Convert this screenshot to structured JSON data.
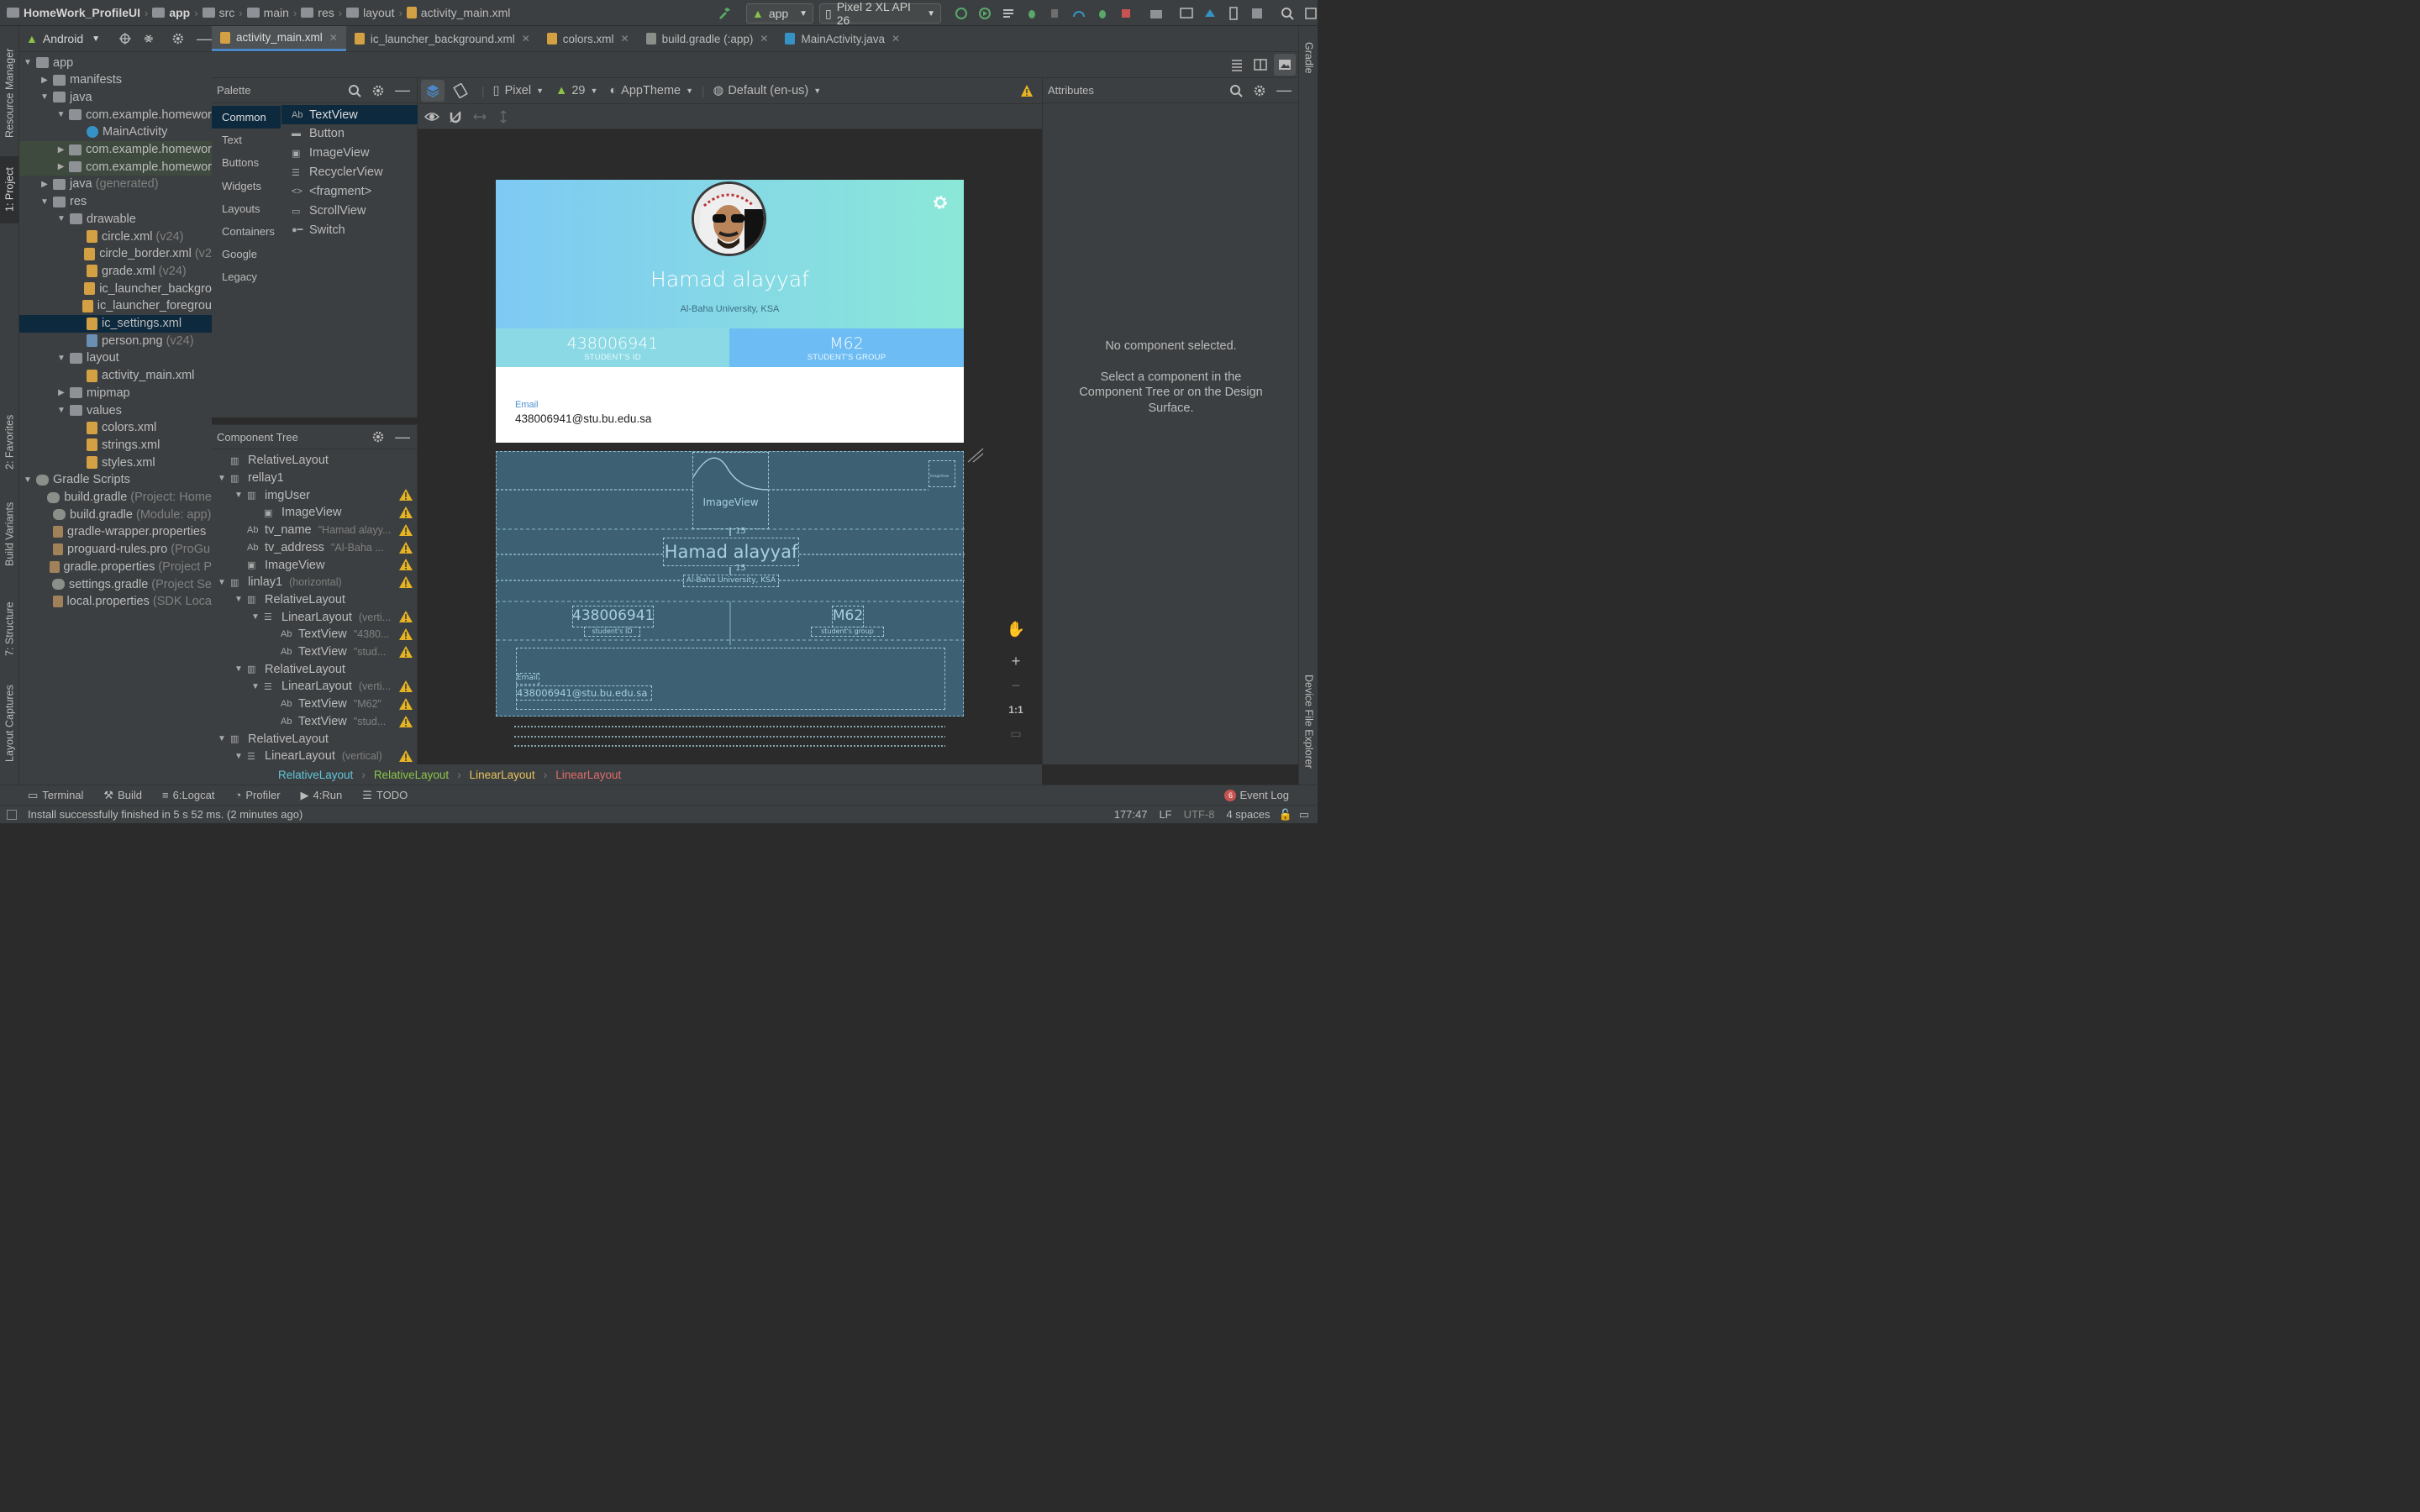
{
  "breadcrumbs": {
    "project": "HomeWork_ProfileUI",
    "items": [
      "app",
      "src",
      "main",
      "res",
      "layout",
      "activity_main.xml"
    ]
  },
  "toolbar": {
    "run_config": "app",
    "device": "Pixel 2 XL API 26"
  },
  "left_stripe": {
    "resource_manager": "Resource Manager",
    "project": "1: Project",
    "favorites": "2: Favorites",
    "build_variants": "Build Variants",
    "structure": "7: Structure",
    "layout_captures": "Layout Captures"
  },
  "right_stripe": {
    "gradle": "Gradle",
    "device_file_explorer": "Device File Explorer"
  },
  "project_panel": {
    "view_mode": "Android",
    "tree": [
      {
        "label": "app",
        "hint": "",
        "kind": "dir",
        "level": 0,
        "arrow": "down"
      },
      {
        "label": "manifests",
        "hint": "",
        "kind": "dir",
        "level": 1,
        "arrow": "right"
      },
      {
        "label": "java",
        "hint": "",
        "kind": "dir",
        "level": 1,
        "arrow": "down"
      },
      {
        "label": "com.example.homewor",
        "hint": "",
        "kind": "dir",
        "level": 2,
        "arrow": "down"
      },
      {
        "label": "MainActivity",
        "hint": "",
        "kind": "cls",
        "level": 3,
        "arrow": ""
      },
      {
        "label": "com.example.homewor",
        "hint": "",
        "kind": "dir",
        "level": 2,
        "arrow": "right",
        "hl": true
      },
      {
        "label": "com.example.homewor",
        "hint": "",
        "kind": "dir",
        "level": 2,
        "arrow": "right",
        "hl": true
      },
      {
        "label": "java",
        "hint": "(generated)",
        "kind": "dir",
        "level": 1,
        "arrow": "right"
      },
      {
        "label": "res",
        "hint": "",
        "kind": "dir",
        "level": 1,
        "arrow": "down"
      },
      {
        "label": "drawable",
        "hint": "",
        "kind": "dir",
        "level": 2,
        "arrow": "down"
      },
      {
        "label": "circle.xml",
        "hint": "(v24)",
        "kind": "xml",
        "level": 3,
        "arrow": ""
      },
      {
        "label": "circle_border.xml",
        "hint": "(v2",
        "kind": "xml",
        "level": 3,
        "arrow": ""
      },
      {
        "label": "grade.xml",
        "hint": "(v24)",
        "kind": "xml",
        "level": 3,
        "arrow": ""
      },
      {
        "label": "ic_launcher_backgro",
        "hint": "",
        "kind": "xml",
        "level": 3,
        "arrow": ""
      },
      {
        "label": "ic_launcher_foregrou",
        "hint": "",
        "kind": "xml",
        "level": 3,
        "arrow": ""
      },
      {
        "label": "ic_settings.xml",
        "hint": "",
        "kind": "xml",
        "level": 3,
        "arrow": "",
        "sel": true
      },
      {
        "label": "person.png",
        "hint": "(v24)",
        "kind": "png",
        "level": 3,
        "arrow": ""
      },
      {
        "label": "layout",
        "hint": "",
        "kind": "dir",
        "level": 2,
        "arrow": "down"
      },
      {
        "label": "activity_main.xml",
        "hint": "",
        "kind": "xml",
        "level": 3,
        "arrow": ""
      },
      {
        "label": "mipmap",
        "hint": "",
        "kind": "dir",
        "level": 2,
        "arrow": "right"
      },
      {
        "label": "values",
        "hint": "",
        "kind": "dir",
        "level": 2,
        "arrow": "down"
      },
      {
        "label": "colors.xml",
        "hint": "",
        "kind": "xml",
        "level": 3,
        "arrow": ""
      },
      {
        "label": "strings.xml",
        "hint": "",
        "kind": "xml",
        "level": 3,
        "arrow": ""
      },
      {
        "label": "styles.xml",
        "hint": "",
        "kind": "xml",
        "level": 3,
        "arrow": ""
      },
      {
        "label": "Gradle Scripts",
        "hint": "",
        "kind": "grd",
        "level": 0,
        "arrow": "down"
      },
      {
        "label": "build.gradle",
        "hint": "(Project: Home",
        "kind": "grd",
        "level": 1,
        "arrow": ""
      },
      {
        "label": "build.gradle",
        "hint": "(Module: app)",
        "kind": "grd",
        "level": 1,
        "arrow": ""
      },
      {
        "label": "gradle-wrapper.properties",
        "hint": "",
        "kind": "prop",
        "level": 1,
        "arrow": ""
      },
      {
        "label": "proguard-rules.pro",
        "hint": "(ProGu",
        "kind": "prop",
        "level": 1,
        "arrow": ""
      },
      {
        "label": "gradle.properties",
        "hint": "(Project P",
        "kind": "prop",
        "level": 1,
        "arrow": ""
      },
      {
        "label": "settings.gradle",
        "hint": "(Project Se",
        "kind": "grd",
        "level": 1,
        "arrow": ""
      },
      {
        "label": "local.properties",
        "hint": "(SDK Loca",
        "kind": "prop",
        "level": 1,
        "arrow": ""
      }
    ]
  },
  "editor_tabs": [
    {
      "label": "activity_main.xml",
      "active": true,
      "color": "#d4a044"
    },
    {
      "label": "ic_launcher_background.xml",
      "active": false,
      "color": "#d4a044"
    },
    {
      "label": "colors.xml",
      "active": false,
      "color": "#d4a044"
    },
    {
      "label": "build.gradle (:app)",
      "active": false,
      "color": "#8a8f8a"
    },
    {
      "label": "MainActivity.java",
      "active": false,
      "color": "#3592c4"
    }
  ],
  "palette": {
    "title": "Palette",
    "categories": [
      "Common",
      "Text",
      "Buttons",
      "Widgets",
      "Layouts",
      "Containers",
      "Google",
      "Legacy"
    ],
    "items": [
      {
        "glyph": "Ab",
        "label": "TextView"
      },
      {
        "glyph": "▬",
        "label": "Button"
      },
      {
        "glyph": "▣",
        "label": "ImageView"
      },
      {
        "glyph": "☰",
        "label": "RecyclerView"
      },
      {
        "glyph": "<>",
        "label": "<fragment>"
      },
      {
        "glyph": "▭",
        "label": "ScrollView"
      },
      {
        "glyph": "●━",
        "label": "Switch"
      }
    ]
  },
  "design_toolbar": {
    "device": "Pixel",
    "api": "29",
    "theme": "AppTheme",
    "locale": "Default (en-us)"
  },
  "component_tree": {
    "title": "Component Tree",
    "rows": [
      {
        "glyph": "▥",
        "label": "RelativeLayout",
        "extra": "",
        "level": 0,
        "arrow": "",
        "warn": false
      },
      {
        "glyph": "▥",
        "label": "rellay1",
        "extra": "",
        "level": 0,
        "arrow": "down",
        "warn": false
      },
      {
        "glyph": "▥",
        "label": "imgUser",
        "extra": "",
        "level": 1,
        "arrow": "down",
        "warn": true
      },
      {
        "glyph": "▣",
        "label": "ImageView",
        "extra": "",
        "level": 2,
        "arrow": "",
        "warn": true
      },
      {
        "glyph": "Ab",
        "label": "tv_name",
        "extra": "\"Hamad alayy...",
        "level": 1,
        "arrow": "",
        "warn": true
      },
      {
        "glyph": "Ab",
        "label": "tv_address",
        "extra": "\"Al-Baha ...",
        "level": 1,
        "arrow": "",
        "warn": true
      },
      {
        "glyph": "▣",
        "label": "ImageView",
        "extra": "",
        "level": 1,
        "arrow": "",
        "warn": true
      },
      {
        "glyph": "▥",
        "label": "linlay1",
        "extra": "(horizontal)",
        "level": 0,
        "arrow": "down",
        "warn": true
      },
      {
        "glyph": "▥",
        "label": "RelativeLayout",
        "extra": "",
        "level": 1,
        "arrow": "down",
        "warn": false
      },
      {
        "glyph": "☰",
        "label": "LinearLayout",
        "extra": "(verti...",
        "level": 2,
        "arrow": "down",
        "warn": true
      },
      {
        "glyph": "Ab",
        "label": "TextView",
        "extra": "\"4380...",
        "level": 3,
        "arrow": "",
        "warn": true
      },
      {
        "glyph": "Ab",
        "label": "TextView",
        "extra": "\"stud...",
        "level": 3,
        "arrow": "",
        "warn": true
      },
      {
        "glyph": "▥",
        "label": "RelativeLayout",
        "extra": "",
        "level": 1,
        "arrow": "down",
        "warn": false
      },
      {
        "glyph": "☰",
        "label": "LinearLayout",
        "extra": "(verti...",
        "level": 2,
        "arrow": "down",
        "warn": true
      },
      {
        "glyph": "Ab",
        "label": "TextView",
        "extra": "\"M62\"",
        "level": 3,
        "arrow": "",
        "warn": true
      },
      {
        "glyph": "Ab",
        "label": "TextView",
        "extra": "\"stud...",
        "level": 3,
        "arrow": "",
        "warn": true
      },
      {
        "glyph": "▥",
        "label": "RelativeLayout",
        "extra": "",
        "level": 0,
        "arrow": "down",
        "warn": false
      },
      {
        "glyph": "☰",
        "label": "LinearLayout",
        "extra": "(vertical)",
        "level": 1,
        "arrow": "down",
        "warn": true
      }
    ]
  },
  "profile": {
    "name": "Hamad alayyaf",
    "address": "Al-Baha University, KSA",
    "student_id": "438006941",
    "student_id_label": "STUDENT'S ID",
    "group": "M62",
    "group_label": "STUDENT'S GROUP",
    "email_label": "Email",
    "email": "438006941@stu.bu.edu.sa"
  },
  "blueprint": {
    "image_label": "ImageView",
    "margin_label": "15",
    "name": "Hamad alayyaf",
    "address": "Al-Baha University, KSA",
    "id": "438006941",
    "id_label": "student's ID",
    "group": "M62",
    "group_label": "student's group",
    "email_label": "Email",
    "email": "438006941@stu.bu.edu.sa",
    "mini_image_label": "ImageView"
  },
  "attributes": {
    "title": "Attributes",
    "empty_title": "No component selected.",
    "empty_hint": "Select a component in the Component Tree or on the Design Surface."
  },
  "zoom_controls": {
    "reset": "1:1"
  },
  "layout_breadcrumb": [
    {
      "label": "RelativeLayout",
      "color": "#62c4d9"
    },
    {
      "label": "RelativeLayout",
      "color": "#8bc34a"
    },
    {
      "label": "LinearLayout",
      "color": "#e6c35c"
    },
    {
      "label": "LinearLayout",
      "color": "#e06c6c"
    }
  ],
  "bottom_tools": [
    {
      "label": "Terminal",
      "prefix": ""
    },
    {
      "label": "Build",
      "prefix": ""
    },
    {
      "label": "Logcat",
      "prefix": "6: "
    },
    {
      "label": "Profiler",
      "prefix": ""
    },
    {
      "label": "Run",
      "prefix": "4: "
    },
    {
      "label": "TODO",
      "prefix": ""
    }
  ],
  "event_log": {
    "count": "6",
    "label": "Event Log"
  },
  "status": {
    "message": "Install successfully finished in 5 s 52 ms. (2 minutes ago)",
    "position": "177:47",
    "line_sep": "LF",
    "encoding": "UTF-8",
    "indent": "4 spaces"
  },
  "colors": {
    "accent": "#4a88c7",
    "warning": "#e6b422",
    "header_gradient_start": "#7ec9f4",
    "header_gradient_end": "#8be8d7",
    "id_box": "#8ad9e4",
    "group_box": "#6ebcf4"
  }
}
